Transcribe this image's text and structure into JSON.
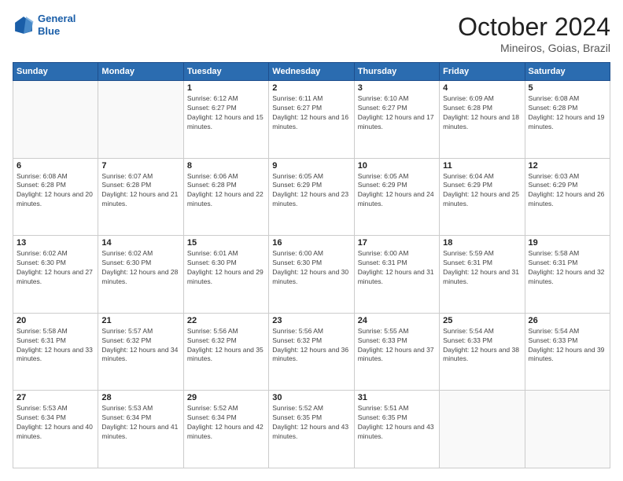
{
  "logo": {
    "line1": "General",
    "line2": "Blue"
  },
  "header": {
    "title": "October 2024",
    "location": "Mineiros, Goias, Brazil"
  },
  "weekdays": [
    "Sunday",
    "Monday",
    "Tuesday",
    "Wednesday",
    "Thursday",
    "Friday",
    "Saturday"
  ],
  "weeks": [
    [
      null,
      null,
      {
        "day": 1,
        "sunrise": "6:12 AM",
        "sunset": "6:27 PM",
        "daylight": "12 hours and 15 minutes."
      },
      {
        "day": 2,
        "sunrise": "6:11 AM",
        "sunset": "6:27 PM",
        "daylight": "12 hours and 16 minutes."
      },
      {
        "day": 3,
        "sunrise": "6:10 AM",
        "sunset": "6:27 PM",
        "daylight": "12 hours and 17 minutes."
      },
      {
        "day": 4,
        "sunrise": "6:09 AM",
        "sunset": "6:28 PM",
        "daylight": "12 hours and 18 minutes."
      },
      {
        "day": 5,
        "sunrise": "6:08 AM",
        "sunset": "6:28 PM",
        "daylight": "12 hours and 19 minutes."
      }
    ],
    [
      {
        "day": 6,
        "sunrise": "6:08 AM",
        "sunset": "6:28 PM",
        "daylight": "12 hours and 20 minutes."
      },
      {
        "day": 7,
        "sunrise": "6:07 AM",
        "sunset": "6:28 PM",
        "daylight": "12 hours and 21 minutes."
      },
      {
        "day": 8,
        "sunrise": "6:06 AM",
        "sunset": "6:28 PM",
        "daylight": "12 hours and 22 minutes."
      },
      {
        "day": 9,
        "sunrise": "6:05 AM",
        "sunset": "6:29 PM",
        "daylight": "12 hours and 23 minutes."
      },
      {
        "day": 10,
        "sunrise": "6:05 AM",
        "sunset": "6:29 PM",
        "daylight": "12 hours and 24 minutes."
      },
      {
        "day": 11,
        "sunrise": "6:04 AM",
        "sunset": "6:29 PM",
        "daylight": "12 hours and 25 minutes."
      },
      {
        "day": 12,
        "sunrise": "6:03 AM",
        "sunset": "6:29 PM",
        "daylight": "12 hours and 26 minutes."
      }
    ],
    [
      {
        "day": 13,
        "sunrise": "6:02 AM",
        "sunset": "6:30 PM",
        "daylight": "12 hours and 27 minutes."
      },
      {
        "day": 14,
        "sunrise": "6:02 AM",
        "sunset": "6:30 PM",
        "daylight": "12 hours and 28 minutes."
      },
      {
        "day": 15,
        "sunrise": "6:01 AM",
        "sunset": "6:30 PM",
        "daylight": "12 hours and 29 minutes."
      },
      {
        "day": 16,
        "sunrise": "6:00 AM",
        "sunset": "6:30 PM",
        "daylight": "12 hours and 30 minutes."
      },
      {
        "day": 17,
        "sunrise": "6:00 AM",
        "sunset": "6:31 PM",
        "daylight": "12 hours and 31 minutes."
      },
      {
        "day": 18,
        "sunrise": "5:59 AM",
        "sunset": "6:31 PM",
        "daylight": "12 hours and 31 minutes."
      },
      {
        "day": 19,
        "sunrise": "5:58 AM",
        "sunset": "6:31 PM",
        "daylight": "12 hours and 32 minutes."
      }
    ],
    [
      {
        "day": 20,
        "sunrise": "5:58 AM",
        "sunset": "6:31 PM",
        "daylight": "12 hours and 33 minutes."
      },
      {
        "day": 21,
        "sunrise": "5:57 AM",
        "sunset": "6:32 PM",
        "daylight": "12 hours and 34 minutes."
      },
      {
        "day": 22,
        "sunrise": "5:56 AM",
        "sunset": "6:32 PM",
        "daylight": "12 hours and 35 minutes."
      },
      {
        "day": 23,
        "sunrise": "5:56 AM",
        "sunset": "6:32 PM",
        "daylight": "12 hours and 36 minutes."
      },
      {
        "day": 24,
        "sunrise": "5:55 AM",
        "sunset": "6:33 PM",
        "daylight": "12 hours and 37 minutes."
      },
      {
        "day": 25,
        "sunrise": "5:54 AM",
        "sunset": "6:33 PM",
        "daylight": "12 hours and 38 minutes."
      },
      {
        "day": 26,
        "sunrise": "5:54 AM",
        "sunset": "6:33 PM",
        "daylight": "12 hours and 39 minutes."
      }
    ],
    [
      {
        "day": 27,
        "sunrise": "5:53 AM",
        "sunset": "6:34 PM",
        "daylight": "12 hours and 40 minutes."
      },
      {
        "day": 28,
        "sunrise": "5:53 AM",
        "sunset": "6:34 PM",
        "daylight": "12 hours and 41 minutes."
      },
      {
        "day": 29,
        "sunrise": "5:52 AM",
        "sunset": "6:34 PM",
        "daylight": "12 hours and 42 minutes."
      },
      {
        "day": 30,
        "sunrise": "5:52 AM",
        "sunset": "6:35 PM",
        "daylight": "12 hours and 43 minutes."
      },
      {
        "day": 31,
        "sunrise": "5:51 AM",
        "sunset": "6:35 PM",
        "daylight": "12 hours and 43 minutes."
      },
      null,
      null
    ]
  ]
}
